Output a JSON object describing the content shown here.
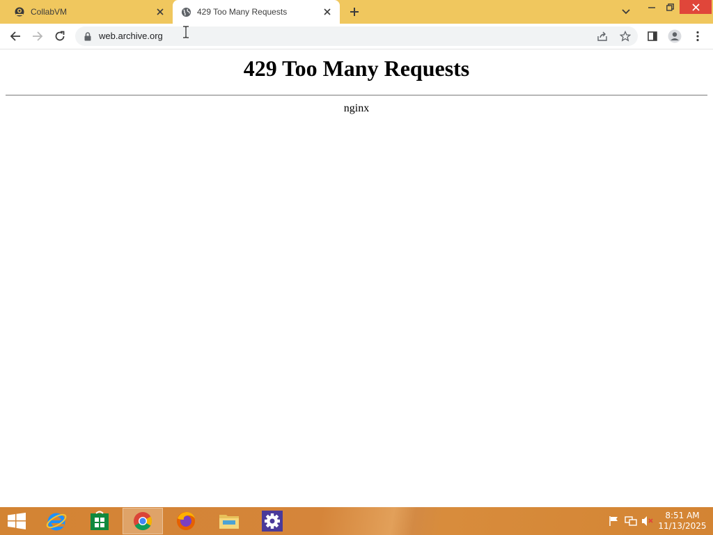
{
  "tabs": [
    {
      "title": "CollabVM",
      "icon": "collabvm-icon",
      "active": false
    },
    {
      "title": "429 Too Many Requests",
      "icon": "globe-icon",
      "active": true
    }
  ],
  "address_bar": {
    "url": "web.archive.org",
    "secure": true
  },
  "page": {
    "heading": "429 Too Many Requests",
    "server": "nginx"
  },
  "taskbar": {
    "apps": [
      "start",
      "internet-explorer",
      "store",
      "chrome",
      "firefox",
      "file-explorer",
      "settings"
    ],
    "active_app": "chrome",
    "clock": {
      "time": "8:51 AM",
      "date": "11/13/2025"
    }
  },
  "colors": {
    "tabstrip": "#f0c75e",
    "taskbar": "#d38433",
    "close": "#e0463a"
  }
}
